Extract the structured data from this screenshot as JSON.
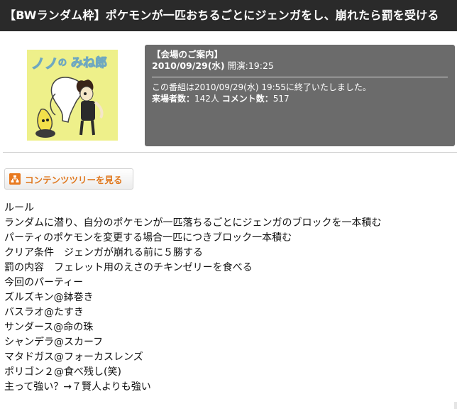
{
  "title": "【BWランダム枠】ポケモンが一匹おちるごとにジェンガをし、崩れたら罰を受ける",
  "thumbnail": {
    "lettering": "ノノのみね郎",
    "bg_color": "#eef08a"
  },
  "info": {
    "heading": "【会場のご案内】",
    "date_bold": "2010/09/29(水)",
    "date_rest": " 開演:19:25",
    "ended_text": "この番組は2010/09/29(水) 19:55に終了いたしました。",
    "visitors_label": "来場者数：",
    "visitors_value": "142人",
    "comments_label": "コメント数：",
    "comments_value": "517"
  },
  "tree_button": {
    "label": "コンテンツツリーを見る",
    "icon": "tree-icon",
    "color": "#e0781e"
  },
  "description": [
    "ルール",
    "ランダムに潜り、自分のポケモンが一匹落ちるごとにジェンガのブロックを一本積む",
    "パーティのポケモンを変更する場合一匹につきブロック一本積む",
    "クリア条件　ジェンガが崩れる前に５勝する",
    "罰の内容　フェレット用のえさのチキンゼリーを食べる",
    "今回のパーティー",
    "ズルズキン@鉢巻き",
    "バスラオ@たすき",
    "サンダース@命の珠",
    "シャンデラ@スカーフ",
    "マタドガス@フォーカスレンズ",
    "ポリゴン２@食べ残し(笑)",
    "主って強い？→７賢人よりも強い"
  ]
}
